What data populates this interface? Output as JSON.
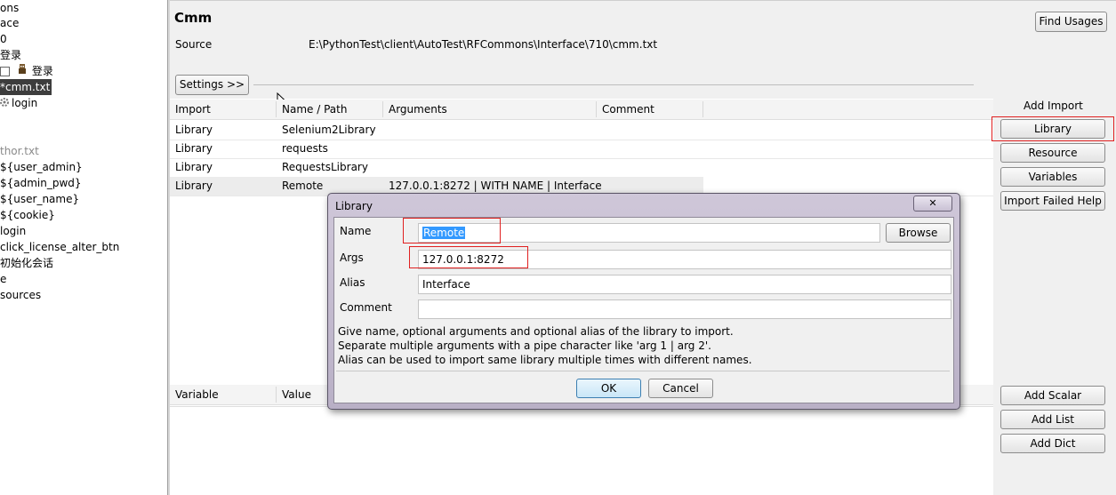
{
  "tree": {
    "items": [
      {
        "label": "ons",
        "grey": false
      },
      {
        "label": "ace",
        "grey": false
      },
      {
        "label": "0",
        "grey": false
      },
      {
        "label": "登录",
        "grey": false
      },
      {
        "label": "登录",
        "grey": false
      },
      {
        "label": "*cmm.txt",
        "grey": false
      },
      {
        "label": "login",
        "grey": false
      },
      {
        "label": "thor.txt",
        "grey": true
      },
      {
        "label": "${user_admin}",
        "grey": false
      },
      {
        "label": "${admin_pwd}",
        "grey": false
      },
      {
        "label": "${user_name}",
        "grey": false
      },
      {
        "label": "${cookie}",
        "grey": false
      },
      {
        "label": "login",
        "grey": false
      },
      {
        "label": "click_license_alter_btn",
        "grey": false
      },
      {
        "label": "初始化会话",
        "grey": false
      },
      {
        "label": "e",
        "grey": false
      },
      {
        "label": "sources",
        "grey": false
      }
    ]
  },
  "editor": {
    "title": "Cmm",
    "find_usages": "Find Usages",
    "source_label": "Source",
    "source_path": "E:\\PythonTest\\client\\AutoTest\\RFCommons\\Interface\\710\\cmm.txt",
    "settings_button": "Settings >>"
  },
  "imports": {
    "headers": [
      "Import",
      "Name / Path",
      "Arguments",
      "Comment"
    ],
    "rows": [
      {
        "type": "Library",
        "name": "Selenium2Library",
        "args": "",
        "comment": ""
      },
      {
        "type": "Library",
        "name": "requests",
        "args": "",
        "comment": ""
      },
      {
        "type": "Library",
        "name": "RequestsLibrary",
        "args": "",
        "comment": ""
      },
      {
        "type": "Library",
        "name": "Remote",
        "args": "127.0.0.1:8272 | WITH NAME | Interface",
        "comment": ""
      }
    ]
  },
  "add_import": {
    "title": "Add Import",
    "buttons": [
      "Library",
      "Resource",
      "Variables",
      "Import Failed Help"
    ]
  },
  "variables": {
    "headers": [
      "Variable",
      "Value"
    ],
    "buttons": [
      "Add Scalar",
      "Add List",
      "Add Dict"
    ]
  },
  "dialog": {
    "title": "Library",
    "close_glyph": "✕",
    "name_label": "Name",
    "name_value": "Remote",
    "browse": "Browse",
    "args_label": "Args",
    "args_value": "127.0.0.1:8272",
    "alias_label": "Alias",
    "alias_value": "Interface",
    "comment_label": "Comment",
    "comment_value": "",
    "help_lines": [
      "Give name, optional arguments and optional alias of the library to import.",
      "Separate multiple arguments with a pipe character like 'arg 1 | arg 2'.",
      "Alias can be used to import same library multiple times with different names."
    ],
    "ok": "OK",
    "cancel": "Cancel"
  },
  "colors": {
    "highlight": "#e02020",
    "selection": "#3399ff",
    "panel": "#f0f0f0"
  }
}
